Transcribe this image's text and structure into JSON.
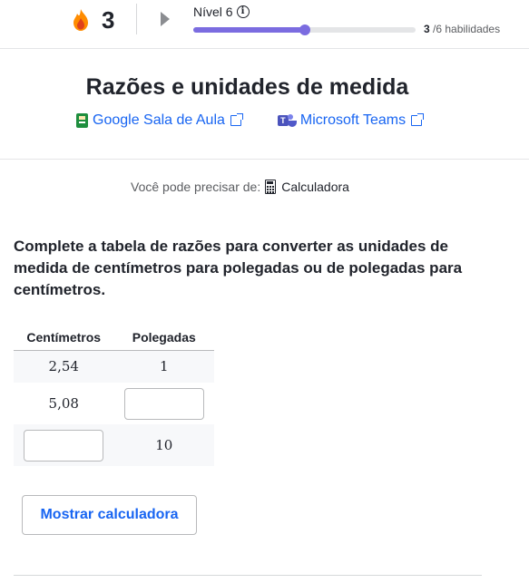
{
  "header": {
    "streak_count": "3",
    "level_label": "Nível 6",
    "progress_fraction": 0.5,
    "skills_done": "3",
    "skills_total": "/6 habilidades"
  },
  "lesson": {
    "title": "Razões e unidades de medida",
    "share": {
      "google_classroom": "Google Sala de Aula",
      "microsoft_teams": "Microsoft Teams"
    }
  },
  "tools": {
    "prefix": "Você pode precisar de:",
    "calculator": "Calculadora"
  },
  "question": {
    "text": "Complete a tabela de razões para converter as unidades de medida de centímetros para polegadas ou de polegadas para centímetros."
  },
  "table": {
    "headers": [
      "Centímetros",
      "Polegadas"
    ],
    "rows": [
      [
        "2,54",
        "1"
      ],
      [
        "5,08",
        ""
      ],
      [
        "",
        "10"
      ]
    ]
  },
  "actions": {
    "show_calculator": "Mostrar calculadora"
  },
  "colors": {
    "accent": "#1865f2",
    "progress": "#7b6ce0",
    "flame": "#ff8c00"
  },
  "icons": [
    "flame-icon",
    "play-icon",
    "info-icon",
    "google-classroom-icon",
    "external-link-icon",
    "microsoft-teams-icon",
    "calculator-icon"
  ]
}
